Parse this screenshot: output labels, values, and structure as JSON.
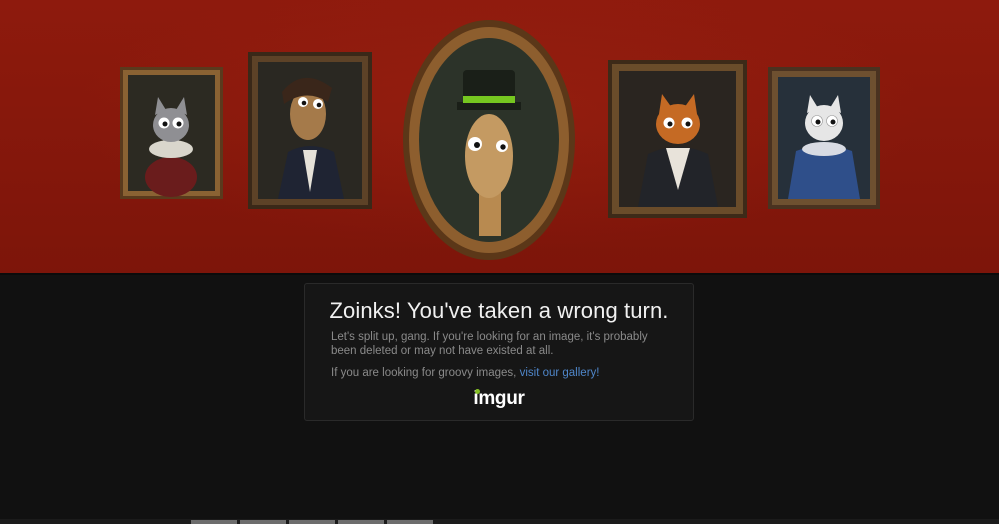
{
  "error": {
    "heading": "Zoinks! You've taken a wrong turn.",
    "message": "Let's split up, gang. If you're looking for an image, it's probably been deleted or may not have existed at all.",
    "gallery_prefix": "If you are looking for groovy images, ",
    "gallery_link": "visit our gallery!"
  },
  "logo": {
    "text_first": "i",
    "text_rest": "mgur",
    "dot_color": "#85bf25"
  },
  "banner": {
    "background_color": "#8e1a0d",
    "portraits": [
      {
        "subject": "grey cat in ruff collar",
        "icon": "cat-portrait-icon"
      },
      {
        "subject": "ferret in coat",
        "icon": "ferret-portrait-icon"
      },
      {
        "subject": "giraffe in green top hat",
        "icon": "giraffe-portrait-icon"
      },
      {
        "subject": "orange cat in cravat",
        "icon": "cat-portrait-icon"
      },
      {
        "subject": "white cat in blue dress",
        "icon": "cat-portrait-icon"
      }
    ]
  },
  "colors": {
    "page_background": "#111111",
    "link": "#4f86c9",
    "heading": "#f1f1f1",
    "body_text": "#8a8a8a"
  }
}
